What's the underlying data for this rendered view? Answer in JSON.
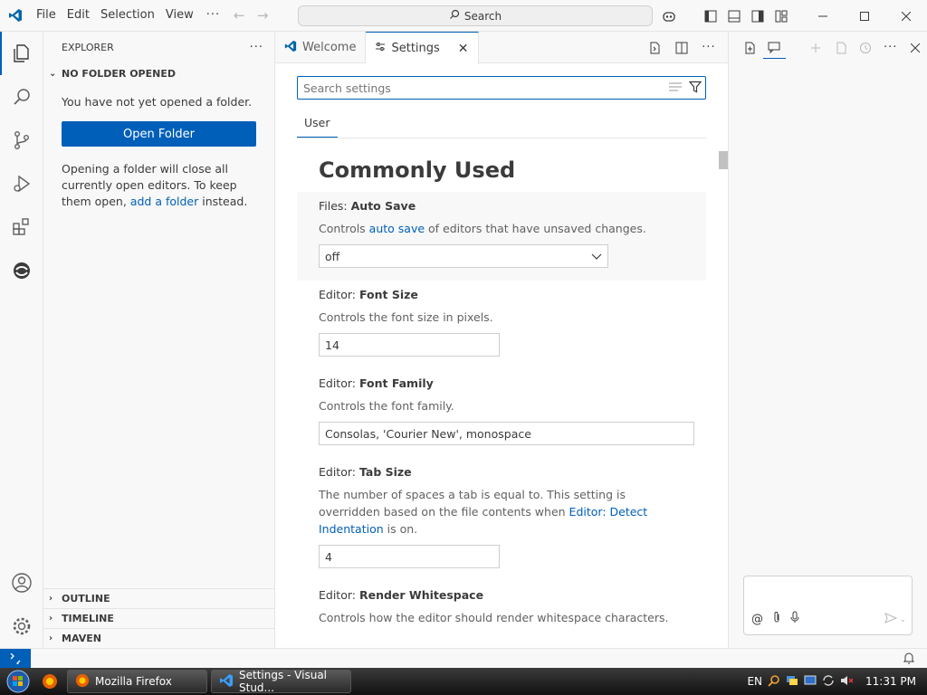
{
  "titlebar": {
    "menus": [
      "File",
      "Edit",
      "Selection",
      "View"
    ],
    "more": "···",
    "search_label": "Search"
  },
  "sidebar": {
    "header": "EXPLORER",
    "more": "···",
    "section_title": "NO FOLDER OPENED",
    "message": "You have not yet opened a folder.",
    "open_folder_label": "Open Folder",
    "info_prefix": "Opening a folder will close all currently open editors. To keep them open,",
    "info_link": "add a folder",
    "info_suffix": "instead.",
    "bottom_sections": [
      "OUTLINE",
      "TIMELINE",
      "MAVEN"
    ]
  },
  "editor": {
    "tabs": [
      {
        "label": "Welcome",
        "active": false
      },
      {
        "label": "Settings",
        "active": true
      }
    ],
    "search_placeholder": "Search settings",
    "scope_tab": "User",
    "group_title": "Commonly Used",
    "settings": {
      "auto_save": {
        "category": "Files: ",
        "name": "Auto Save",
        "desc_prefix": "Controls ",
        "desc_link": "auto save",
        "desc_suffix": " of editors that have unsaved changes.",
        "value": "off"
      },
      "font_size": {
        "category": "Editor: ",
        "name": "Font Size",
        "desc": "Controls the font size in pixels.",
        "value": "14"
      },
      "font_family": {
        "category": "Editor: ",
        "name": "Font Family",
        "desc": "Controls the font family.",
        "value": "Consolas, 'Courier New', monospace"
      },
      "tab_size": {
        "category": "Editor: ",
        "name": "Tab Size",
        "desc_prefix": "The number of spaces a tab is equal to. This setting is overridden based on the file contents when ",
        "desc_link": "Editor: Detect Indentation",
        "desc_suffix": " is on.",
        "value": "4"
      },
      "render_whitespace": {
        "category": "Editor: ",
        "name": "Render Whitespace",
        "desc": "Controls how the editor should render whitespace characters."
      }
    }
  },
  "taskbar": {
    "items": [
      "Mozilla Firefox",
      "Settings - Visual Stud..."
    ],
    "lang": "EN",
    "time": "11:31 PM"
  },
  "colors": {
    "accent": "#005fb8",
    "background": "#f8f8f8",
    "editor_bg": "#ffffff"
  }
}
